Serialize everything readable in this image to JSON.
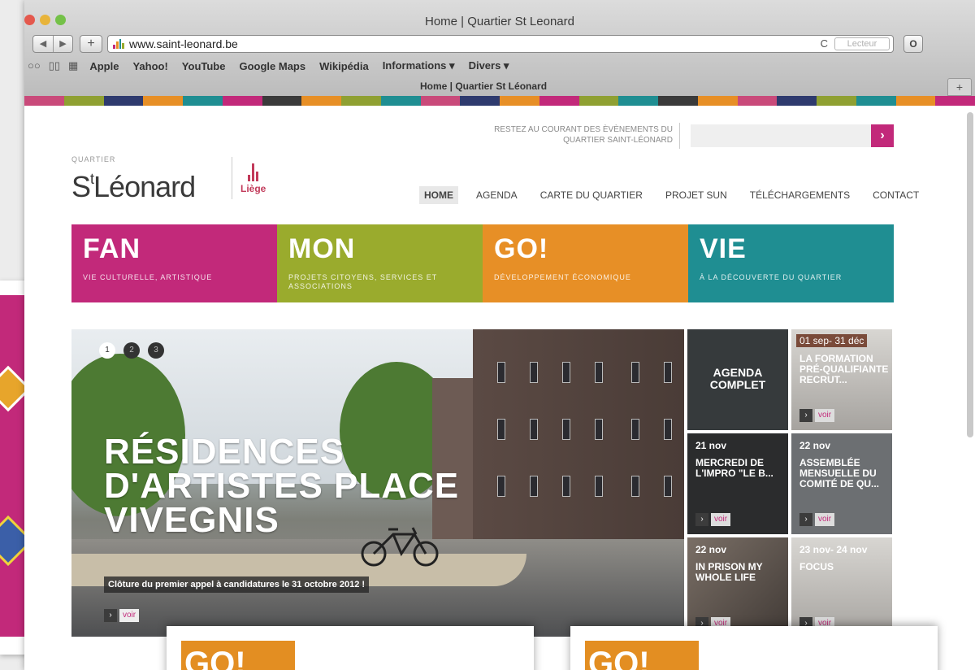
{
  "window": {
    "title": "Home | Quartier St Leonard",
    "url": "www.saint-leonard.be",
    "reader_label": "Lecteur",
    "tab_title": "Home | Quartier St Léonard"
  },
  "bookmarks": [
    "Apple",
    "Yahoo!",
    "YouTube",
    "Google Maps",
    "Wikipédia",
    "Informations ▾",
    "Divers ▾"
  ],
  "colors": {
    "accent": "#c2297a",
    "stripe": [
      "#c94a7a",
      "#8fa032",
      "#2e3a6e",
      "#e78f26",
      "#1f8e92",
      "#c2297a",
      "#3a3a3a",
      "#e78f26",
      "#8fa032",
      "#1f8e92",
      "#c94a7a",
      "#2e3a6e",
      "#e78f26",
      "#c2297a",
      "#8fa032",
      "#1f8e92",
      "#3a3a3a",
      "#e78f26",
      "#c94a7a",
      "#2e3a6e",
      "#8fa032",
      "#1f8e92",
      "#e78f26",
      "#c2297a"
    ]
  },
  "header": {
    "newsletter": "RESTEZ AU COURANT DES ÈVÈNEMENTS DU QUARTIER SAINT-LÉONARD",
    "search_button": "›"
  },
  "logo": {
    "small": "QUARTIER",
    "main": "St Léonard",
    "main_prefix": "S",
    "main_sup": "t",
    "main_rest": "Léonard",
    "city": "Liège"
  },
  "nav": [
    "HOME",
    "AGENDA",
    "CARTE DU QUARTIER",
    "PROJET SUN",
    "TÉLÉCHARGEMENTS",
    "CONTACT"
  ],
  "tiles": [
    {
      "title": "FAN",
      "subtitle": "VIE CULTURELLE, ARTISTIQUE",
      "color": "#c2297a"
    },
    {
      "title": "MON",
      "subtitle": "PROJETS CITOYENS, SERVICES ET ASSOCIATIONS",
      "color": "#9aab2d"
    },
    {
      "title": "GO!",
      "subtitle": "DÉVELOPPEMENT ÉCONOMIQUE",
      "color": "#e78f26"
    },
    {
      "title": "VIE",
      "subtitle": "À LA DÉCOUVERTE DU QUARTIER",
      "color": "#1f8e92"
    }
  ],
  "hero": {
    "dots": [
      "1",
      "2",
      "3"
    ],
    "title": "RÉSIDENCES D'ARTISTES PLACE VIVEGNIS",
    "caption": "Clôture du premier appel à candidatures le 31 octobre 2012 !",
    "voir": "voir"
  },
  "agenda": {
    "complete": "AGENDA COMPLET",
    "items": [
      {
        "date": "01 sep- 31 déc",
        "title": "LA FORMATION PRÉ-QUALIFIANTE RECRUT...",
        "voir": "voir"
      },
      {
        "date": "21 nov",
        "title": "MERCREDI DE L'IMPRO \"LE B...",
        "voir": "voir"
      },
      {
        "date": "22 nov",
        "title": "ASSEMBLÉE MENSUELLE DU COMITÉ DE QU...",
        "voir": "voir"
      },
      {
        "date": "22 nov",
        "title": "IN PRISON MY WHOLE LIFE",
        "voir": "voir"
      },
      {
        "date": "23 nov- 24 nov",
        "title": "FOCUS",
        "voir": "voir"
      }
    ]
  },
  "cards": [
    "GO!",
    "GO!"
  ]
}
